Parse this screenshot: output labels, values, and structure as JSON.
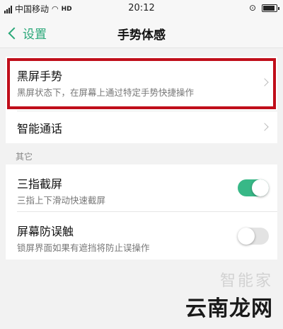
{
  "status_bar": {
    "carrier": "中国移动",
    "network": "HD",
    "time": "20:12",
    "battery_level": 0.85,
    "icons": [
      "signal-icon",
      "wifi-icon",
      "alarm-icon",
      "battery-icon"
    ]
  },
  "nav": {
    "back_label": "设置",
    "title": "手势体感"
  },
  "rows": [
    {
      "title": "黑屏手势",
      "subtitle": "黑屏状态下，在屏幕上通过特定手势快捷操作"
    },
    {
      "title": "智能通话"
    }
  ],
  "section": {
    "label": "其它",
    "items": [
      {
        "title": "三指截屏",
        "subtitle": "三指上下滑动快速截屏",
        "enabled": true
      },
      {
        "title": "屏幕防误触",
        "subtitle": "锁屏界面如果有遮挡将防止误操作",
        "enabled": false
      }
    ]
  },
  "watermark": {
    "top": "智能家",
    "bottom": "云南龙网"
  },
  "colors": {
    "accent": "#2aa879",
    "toggle_on": "#38b887",
    "highlight": "#c00e1a"
  }
}
